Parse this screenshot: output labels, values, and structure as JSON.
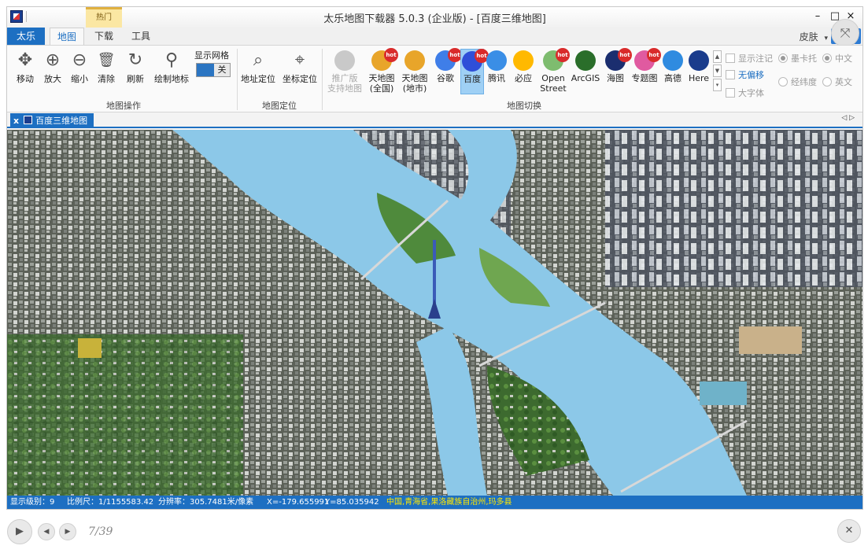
{
  "window": {
    "title": "太乐地图下载器 5.0.3 (企业版) - [百度三维地图]",
    "hot_tab": "热门",
    "minimize": "–",
    "maximize": "□",
    "close": "×"
  },
  "tabs": [
    {
      "label": "太乐",
      "state": "app"
    },
    {
      "label": "地图",
      "state": "active"
    },
    {
      "label": "下载",
      "state": "normal"
    },
    {
      "label": "工具",
      "state": "normal"
    }
  ],
  "skin_label": "皮肤",
  "skin_arrow": "▾",
  "expand_icon": "⤧",
  "ribbon": {
    "map_ops": {
      "label": "地图操作",
      "buttons": [
        {
          "label": "移动",
          "icon": "move-icon",
          "glyph": "✥"
        },
        {
          "label": "放大",
          "icon": "zoom-in-icon",
          "glyph": "⊕"
        },
        {
          "label": "缩小",
          "icon": "zoom-out-icon",
          "glyph": "⊖"
        },
        {
          "label": "清除",
          "icon": "trash-icon",
          "glyph": "🗑"
        },
        {
          "label": "刷新",
          "icon": "refresh-icon",
          "glyph": "↻"
        },
        {
          "label": "绘制地标",
          "icon": "pin-icon",
          "glyph": "⚲"
        }
      ],
      "grid_label": "显示网格",
      "grid_off": "关"
    },
    "locate": {
      "label": "地图定位",
      "buttons": [
        {
          "label": "地址定位",
          "icon": "search-icon",
          "glyph": "⌕"
        },
        {
          "label": "坐标定位",
          "icon": "crosshair-icon",
          "glyph": "⌖"
        }
      ]
    },
    "switch": {
      "label": "地图切换",
      "buttons": [
        {
          "line1": "推广版",
          "line2": "支持地图",
          "icon": "promo-map-icon",
          "color": "#c9c9c9",
          "hot": false,
          "dim": true,
          "selected": false
        },
        {
          "line1": "天地图",
          "line2": "(全国)",
          "icon": "tianditu-national-icon",
          "color": "#e8a52a",
          "hot": true,
          "dim": false,
          "selected": false
        },
        {
          "line1": "天地图",
          "line2": "(地市)",
          "icon": "tianditu-city-icon",
          "color": "#e8a52a",
          "hot": false,
          "dim": false,
          "selected": false
        },
        {
          "line1": "谷歌",
          "line2": "",
          "icon": "google-icon",
          "color": "#3f7ee8",
          "hot": true,
          "dim": false,
          "selected": false
        },
        {
          "line1": "百度",
          "line2": "",
          "icon": "baidu-icon",
          "color": "#2f4fd8",
          "hot": true,
          "dim": false,
          "selected": true
        },
        {
          "line1": "腾讯",
          "line2": "",
          "icon": "tencent-icon",
          "color": "#3a8ee6",
          "hot": false,
          "dim": false,
          "selected": false
        },
        {
          "line1": "必应",
          "line2": "",
          "icon": "bing-icon",
          "color": "#ffb900",
          "hot": false,
          "dim": false,
          "selected": false
        },
        {
          "line1": "Open",
          "line2": "Street",
          "icon": "openstreetmap-icon",
          "color": "#7ebc6f",
          "hot": true,
          "dim": false,
          "selected": false
        },
        {
          "line1": "ArcGIS",
          "line2": "",
          "icon": "arcgis-icon",
          "color": "#2a6e2a",
          "hot": false,
          "dim": false,
          "selected": false
        },
        {
          "line1": "海图",
          "line2": "",
          "icon": "sea-chart-icon",
          "color": "#1b2e6f",
          "hot": true,
          "dim": false,
          "selected": false
        },
        {
          "line1": "专题图",
          "line2": "",
          "icon": "thematic-icon",
          "color": "#e05aa0",
          "hot": true,
          "dim": false,
          "selected": false
        },
        {
          "line1": "高德",
          "line2": "",
          "icon": "gaode-icon",
          "color": "#2f8be0",
          "hot": false,
          "dim": false,
          "selected": false
        },
        {
          "line1": "Here",
          "line2": "",
          "icon": "here-icon",
          "color": "#1a3c8c",
          "hot": false,
          "dim": false,
          "selected": false
        }
      ],
      "scroll_up": "▲",
      "scroll_down": "▼",
      "scroll_more": "▾"
    },
    "options": {
      "show_labels": "显示注记",
      "no_offset": "无偏移",
      "big_font": "大字体",
      "mercator": "墨卡托",
      "latlng": "经纬度",
      "chinese": "中文",
      "english": "英文"
    }
  },
  "doc_tab": {
    "close": "x",
    "label": "百度三维地图"
  },
  "tab_arrows": "◁ ▷",
  "status": {
    "level": "显示级别：9",
    "scale": "比例尺：1/1155583.42",
    "resolution": "分辨率：305.7481米/像素",
    "x": "X=-179.655991",
    "y": "Y=85.035942",
    "location": "中国,青海省,果洛藏族自治州,玛多县"
  },
  "gallery": {
    "counter": "7/39",
    "play": "▶",
    "prev": "◀",
    "next": "▶",
    "close": "✕"
  },
  "colors": {
    "accent": "#1d6fc2",
    "river": "#8cc8e8",
    "status_location": "#ffe700"
  }
}
